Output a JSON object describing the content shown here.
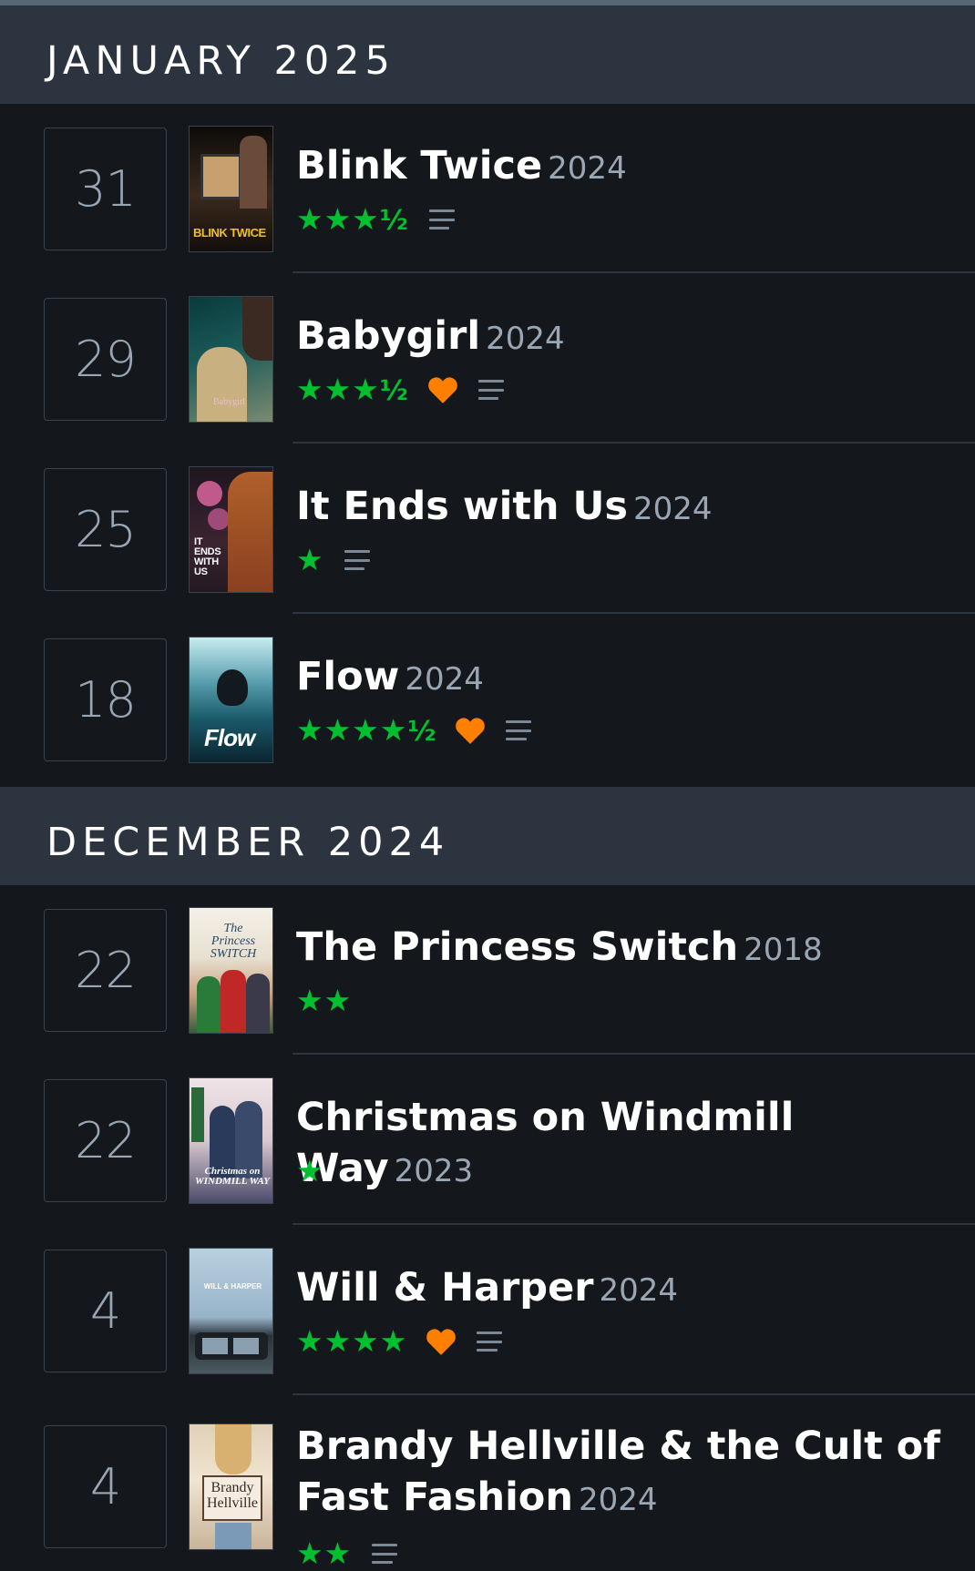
{
  "months": [
    {
      "label": "JANUARY 2025",
      "entries": [
        {
          "day": "31",
          "title": "Blink Twice",
          "year": "2024",
          "stars": "★★★",
          "half": "½",
          "liked": false,
          "review": true,
          "poster_text": "BLINK TWICE",
          "poster_colors": [
            "#1a1410",
            "#5a3a22"
          ]
        },
        {
          "day": "29",
          "title": "Babygirl",
          "year": "2024",
          "stars": "★★★",
          "half": "½",
          "liked": true,
          "review": true,
          "poster_text": "Babygirl",
          "poster_colors": [
            "#0f3a3a",
            "#5a7a6a"
          ]
        },
        {
          "day": "25",
          "title": "It Ends with Us",
          "year": "2024",
          "stars": "★",
          "half": "",
          "liked": false,
          "review": true,
          "poster_text": "IT ENDS WITH US",
          "poster_colors": [
            "#2a1a24",
            "#8a4a3a"
          ]
        },
        {
          "day": "18",
          "title": "Flow",
          "year": "2024",
          "stars": "★★★★",
          "half": "½",
          "liked": true,
          "review": true,
          "poster_text": "Flow",
          "poster_colors": [
            "#b8e0e8",
            "#0a2a38"
          ]
        }
      ]
    },
    {
      "label": "DECEMBER 2024",
      "entries": [
        {
          "day": "22",
          "title": "The Princess Switch",
          "year": "2018",
          "stars": "★★",
          "half": "",
          "liked": false,
          "review": false,
          "poster_text": "The Princess SWITCH",
          "poster_colors": [
            "#f2efe8",
            "#2a6a3a"
          ]
        },
        {
          "day": "22",
          "title": "Christmas on Windmill Way",
          "year": "2023",
          "stars": "★",
          "half": "",
          "liked": false,
          "review": false,
          "poster_text": "Christmas on WINDMILL WAY",
          "poster_colors": [
            "#e8dde0",
            "#2a3a5a"
          ]
        },
        {
          "day": "4",
          "title": "Will & Harper",
          "year": "2024",
          "stars": "★★★★",
          "half": "",
          "liked": true,
          "review": true,
          "poster_text": "WILL & HARPER",
          "poster_colors": [
            "#a8c0d0",
            "#3a4a50"
          ]
        },
        {
          "day": "4",
          "title": "Brandy Hellville & the Cult of Fast Fashion",
          "year": "2024",
          "stars": "★★",
          "half": "",
          "liked": false,
          "review": true,
          "poster_text": "Brandy Hellville",
          "poster_colors": [
            "#e8dcc8",
            "#8a6a4a"
          ]
        }
      ]
    }
  ],
  "colors": {
    "background": "#14181c",
    "header": "#2c3440",
    "star": "#00c030",
    "heart": "#ff8000",
    "muted": "#9aa6b4"
  }
}
